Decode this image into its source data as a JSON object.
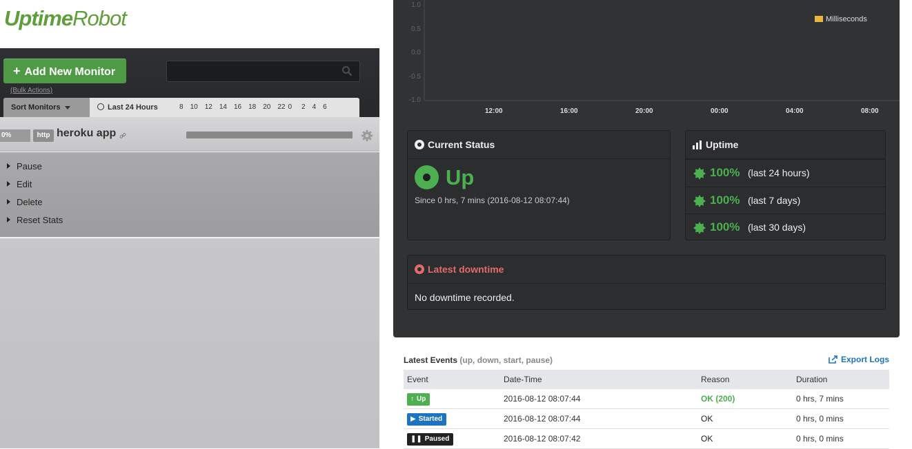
{
  "brand": {
    "logo_part1": "Uptime",
    "logo_part2": "Robot"
  },
  "sidebar": {
    "add_button_label": "Add New Monitor",
    "bulk_actions_label": "(Bulk Actions)",
    "search_placeholder": "",
    "sort_label": "Sort Monitors",
    "range_label": "Last 24 Hours",
    "hours": [
      "8",
      "10",
      "12",
      "14",
      "16",
      "18",
      "20",
      "22",
      "0",
      "2",
      "4",
      "6"
    ],
    "monitor": {
      "uptime_pct": "0%",
      "type_badge": "http",
      "name": "heroku app"
    },
    "actions": [
      "Pause",
      "Edit",
      "Delete",
      "Reset Stats"
    ]
  },
  "chart_data": {
    "type": "line",
    "title": "",
    "xlabel": "",
    "ylabel": "",
    "x_ticks": [
      "12:00",
      "16:00",
      "20:00",
      "00:00",
      "04:00",
      "08:00"
    ],
    "y_ticks": [
      "1.0",
      "0.5",
      "0.0",
      "-0.5",
      "-1.0"
    ],
    "ylim": [
      -1.0,
      1.0
    ],
    "series": [
      {
        "name": "Milliseconds",
        "values": []
      }
    ],
    "legend_position": "top-right",
    "series_color": "#e6b73c"
  },
  "current_status": {
    "title": "Current Status",
    "status": "Up",
    "since": "Since 0 hrs, 7 mins (2016-08-12 08:07:44)",
    "status_color": "#4caf50"
  },
  "uptime": {
    "title": "Uptime",
    "rows": [
      {
        "pct": "100%",
        "label": "(last 24 hours)"
      },
      {
        "pct": "100%",
        "label": "(last 7 days)"
      },
      {
        "pct": "100%",
        "label": "(last 30 days)"
      }
    ]
  },
  "latest_downtime": {
    "title": "Latest downtime",
    "body": "No downtime recorded.",
    "color": "#e26c6c"
  },
  "events": {
    "title": "Latest Events",
    "subtitle": "(up, down, start, pause)",
    "export_label": "Export Logs",
    "columns": [
      "Event",
      "Date-Time",
      "Reason",
      "Duration"
    ],
    "rows": [
      {
        "event": "Up",
        "icon": "arrow-up-icon",
        "color": "#4caf50",
        "datetime": "2016-08-12 08:07:44",
        "reason": "OK (200)",
        "reason_color": "#4caf50",
        "duration": "0 hrs, 7 mins"
      },
      {
        "event": "Started",
        "icon": "play-icon",
        "color": "#1e73be",
        "datetime": "2016-08-12 08:07:44",
        "reason": "OK",
        "reason_color": "#222222",
        "duration": "0 hrs, 0 mins"
      },
      {
        "event": "Paused",
        "icon": "pause-icon",
        "color": "#222222",
        "datetime": "2016-08-12 08:07:42",
        "reason": "OK",
        "reason_color": "#222222",
        "duration": "0 hrs, 0 mins"
      }
    ]
  }
}
